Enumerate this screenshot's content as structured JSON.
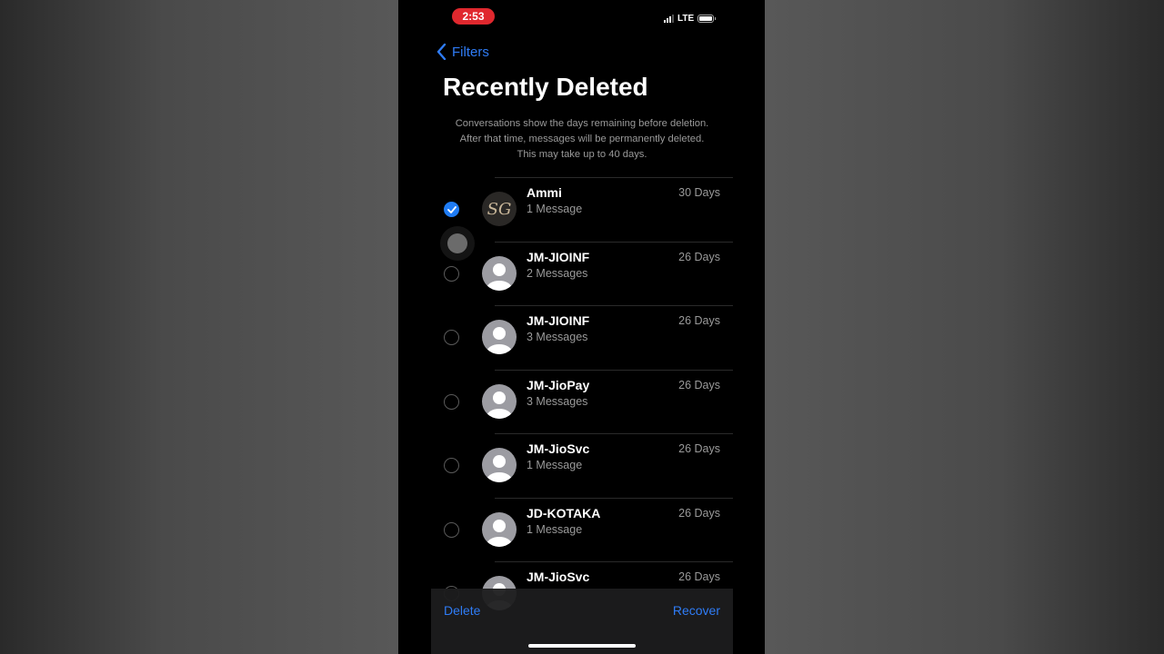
{
  "status_bar": {
    "time": "2:53",
    "network": "LTE"
  },
  "nav": {
    "back_label": "Filters"
  },
  "page": {
    "title": "Recently Deleted",
    "description_lines": [
      "Conversations show the days remaining before deletion.",
      "After that time, messages will be permanently deleted.",
      "This may take up to 40 days."
    ]
  },
  "conversations": [
    {
      "name": "Ammi",
      "count": "1 Message",
      "days": "30 Days",
      "selected": true,
      "avatar": "logo-avatar"
    },
    {
      "name": "JM-JIOINF",
      "count": "2 Messages",
      "days": "26 Days",
      "selected": false,
      "avatar": "person-icon"
    },
    {
      "name": "JM-JIOINF",
      "count": "3 Messages",
      "days": "26 Days",
      "selected": false,
      "avatar": "person-icon"
    },
    {
      "name": "JM-JioPay",
      "count": "3 Messages",
      "days": "26 Days",
      "selected": false,
      "avatar": "person-icon"
    },
    {
      "name": "JM-JioSvc",
      "count": "1 Message",
      "days": "26 Days",
      "selected": false,
      "avatar": "person-icon"
    },
    {
      "name": "JD-KOTAKA",
      "count": "1 Message",
      "days": "26 Days",
      "selected": false,
      "avatar": "person-icon"
    },
    {
      "name": "JM-JioSvc",
      "count": "",
      "days": "26 Days",
      "selected": false,
      "avatar": "person-icon"
    }
  ],
  "toolbar": {
    "delete_label": "Delete",
    "recover_label": "Recover"
  },
  "colors": {
    "accent": "#2f7cf6",
    "time_pill": "#e0282e",
    "background": "#000000"
  }
}
